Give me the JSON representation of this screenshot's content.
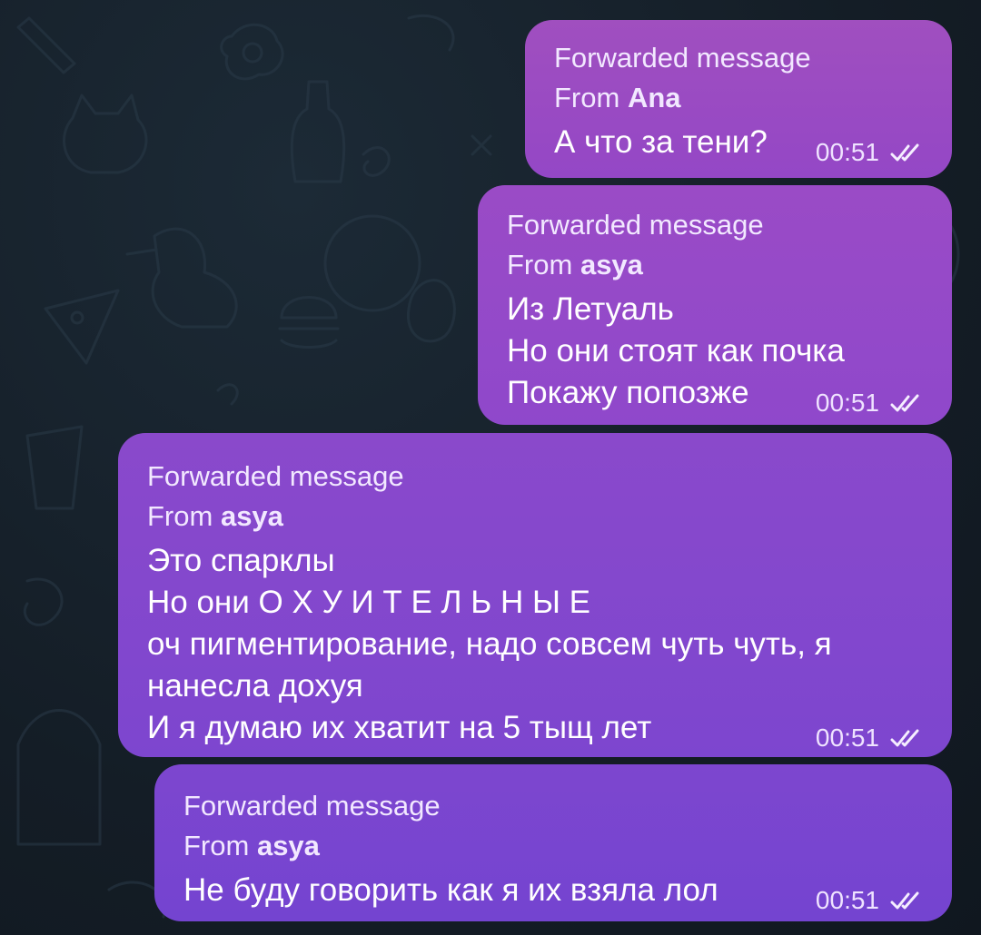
{
  "chat": {
    "messages": [
      {
        "forward_label": "Forwarded message",
        "from_prefix": "From",
        "from_name": "Ana",
        "lines": [
          "А что за тени?"
        ],
        "time": "00:51",
        "status": "read-double-check-icon"
      },
      {
        "forward_label": "Forwarded message",
        "from_prefix": "From",
        "from_name": "asya",
        "lines": [
          "Из Летуаль",
          "Но они стоят как почка",
          "Покажу попозже"
        ],
        "time": "00:51",
        "status": "read-double-check-icon"
      },
      {
        "forward_label": "Forwarded message",
        "from_prefix": "From",
        "from_name": "asya",
        "lines": [
          "Это спарклы",
          "Но они О Х У И Т Е Л Ь Н Ы Е",
          "оч пигментирование, надо совсем чуть чуть, я",
          "нанесла дохуя",
          "И я думаю их хватит на 5 тыщ лет"
        ],
        "time": "00:51",
        "status": "read-double-check-icon"
      },
      {
        "forward_label": "Forwarded message",
        "from_prefix": "From",
        "from_name": "asya",
        "lines": [
          "Не буду говорить как я их взяла лол"
        ],
        "time": "00:51",
        "status": "read-double-check-icon"
      }
    ]
  },
  "colors": {
    "background": "#17212b",
    "bubble_top": "#a04fbf",
    "bubble_bottom": "#7444d0",
    "text": "#ffffff"
  }
}
